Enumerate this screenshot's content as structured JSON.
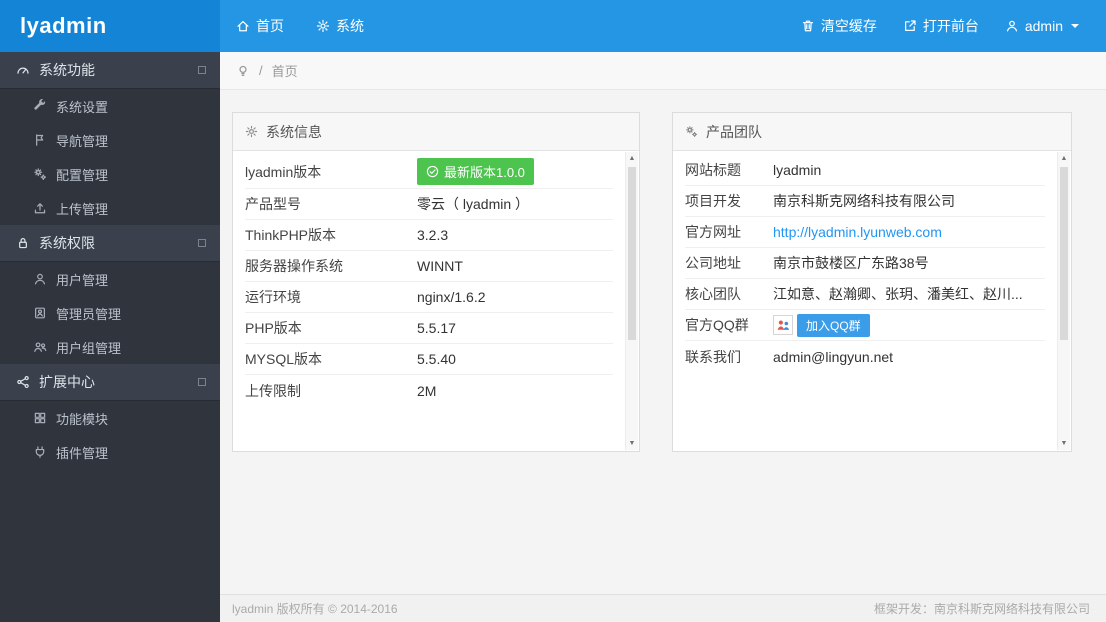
{
  "app": {
    "logo": "lyadmin"
  },
  "colors": {
    "header_blue": "#2596e3",
    "logo_blue": "#1384d6",
    "sidebar_dark": "#2f343d",
    "badge_green": "#4dc44d",
    "link_blue": "#2196f3"
  },
  "header": {
    "nav": [
      {
        "label": "首页",
        "icon": "home-icon",
        "name": "nav-home"
      },
      {
        "label": "系统",
        "icon": "gear-icon",
        "name": "nav-system"
      }
    ],
    "actions": [
      {
        "label": "清空缓存",
        "icon": "trash-icon",
        "name": "clear-cache-button"
      },
      {
        "label": "打开前台",
        "icon": "external-link-icon",
        "name": "open-frontend-button"
      },
      {
        "label": "admin",
        "icon": "user-icon",
        "name": "admin-menu",
        "caret": true
      }
    ]
  },
  "sidebar": {
    "sections": [
      {
        "label": "系统功能",
        "icon": "gauge-icon",
        "name": "system-functions",
        "items": [
          {
            "label": "系统设置",
            "icon": "wrench-icon",
            "name": "system-settings"
          },
          {
            "label": "导航管理",
            "icon": "flag-icon",
            "name": "nav-management"
          },
          {
            "label": "配置管理",
            "icon": "cogs-icon",
            "name": "config-management"
          },
          {
            "label": "上传管理",
            "icon": "upload-icon",
            "name": "upload-management"
          }
        ]
      },
      {
        "label": "系统权限",
        "icon": "lock-icon",
        "name": "system-permissions",
        "items": [
          {
            "label": "用户管理",
            "icon": "user-icon",
            "name": "user-management"
          },
          {
            "label": "管理员管理",
            "icon": "admin-badge-icon",
            "name": "admin-management"
          },
          {
            "label": "用户组管理",
            "icon": "users-group-icon",
            "name": "usergroup-management"
          }
        ]
      },
      {
        "label": "扩展中心",
        "icon": "share-icon",
        "name": "extension-center",
        "items": [
          {
            "label": "功能模块",
            "icon": "grid-icon",
            "name": "function-modules"
          },
          {
            "label": "插件管理",
            "icon": "plugin-icon",
            "name": "plugin-management"
          }
        ]
      }
    ]
  },
  "breadcrumb": {
    "separator": "/",
    "items": [
      "首页"
    ]
  },
  "panels": {
    "system_info": {
      "title": "系统信息",
      "rows": [
        {
          "label": "lyadmin版本",
          "value": "最新版本1.0.0",
          "type": "badge"
        },
        {
          "label": "产品型号",
          "value": "零云（ lyadmin ）"
        },
        {
          "label": "ThinkPHP版本",
          "value": "3.2.3"
        },
        {
          "label": "服务器操作系统",
          "value": "WINNT"
        },
        {
          "label": "运行环境",
          "value": "nginx/1.6.2"
        },
        {
          "label": "PHP版本",
          "value": "5.5.17"
        },
        {
          "label": "MYSQL版本",
          "value": "5.5.40"
        },
        {
          "label": "上传限制",
          "value": "2M"
        }
      ]
    },
    "product_team": {
      "title": "产品团队",
      "rows": [
        {
          "label": "网站标题",
          "value": "lyadmin"
        },
        {
          "label": "项目开发",
          "value": "南京科斯克网络科技有限公司"
        },
        {
          "label": "官方网址",
          "value": "http://lyadmin.lyunweb.com",
          "type": "link"
        },
        {
          "label": "公司地址",
          "value": "南京市鼓楼区广东路38号"
        },
        {
          "label": "核心团队",
          "value": "江如意、赵瀚卿、张玥、潘美红、赵川..."
        },
        {
          "label": "官方QQ群",
          "value": "加入QQ群",
          "type": "qq"
        },
        {
          "label": "联系我们",
          "value": "admin@lingyun.net"
        }
      ]
    }
  },
  "footer": {
    "left": "lyadmin 版权所有 © 2014-2016",
    "right": "框架开发：南京科斯克网络科技有限公司"
  }
}
